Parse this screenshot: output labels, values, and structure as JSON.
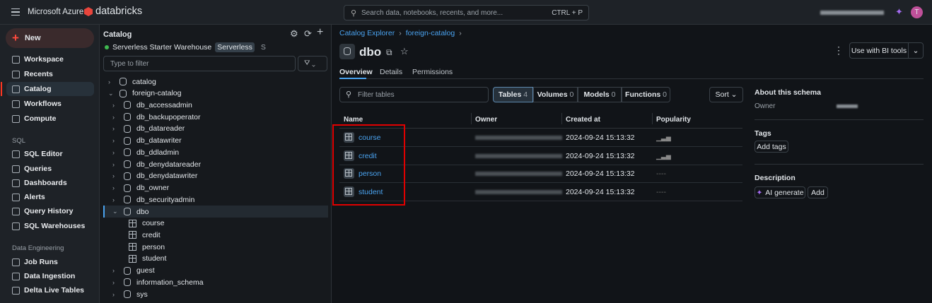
{
  "topbar": {
    "brand": "Microsoft Azure",
    "product": "databricks",
    "search_placeholder": "Search data, notebooks, recents, and more...",
    "search_shortcut": "CTRL + P",
    "avatar": "T"
  },
  "sidebar": {
    "new_label": "New",
    "items": [
      "Workspace",
      "Recents",
      "Catalog",
      "Workflows",
      "Compute"
    ],
    "sql_heading": "SQL",
    "sql_items": [
      "SQL Editor",
      "Queries",
      "Dashboards",
      "Alerts",
      "Query History",
      "SQL Warehouses"
    ],
    "de_heading": "Data Engineering",
    "de_items": [
      "Job Runs",
      "Data Ingestion",
      "Delta Live Tables"
    ]
  },
  "catalog": {
    "title": "Catalog",
    "warehouse": "Serverless Starter Warehouse",
    "warehouse_badge": "Serverless",
    "warehouse_size": "S",
    "filter_placeholder": "Type to filter",
    "tree": [
      {
        "label": "catalog",
        "level": 0,
        "open": false,
        "type": "catalog"
      },
      {
        "label": "foreign-catalog",
        "level": 0,
        "open": true,
        "type": "catalog"
      },
      {
        "label": "db_accessadmin",
        "level": 1,
        "type": "schema"
      },
      {
        "label": "db_backupoperator",
        "level": 1,
        "type": "schema"
      },
      {
        "label": "db_datareader",
        "level": 1,
        "type": "schema"
      },
      {
        "label": "db_datawriter",
        "level": 1,
        "type": "schema"
      },
      {
        "label": "db_ddladmin",
        "level": 1,
        "type": "schema"
      },
      {
        "label": "db_denydatareader",
        "level": 1,
        "type": "schema"
      },
      {
        "label": "db_denydatawriter",
        "level": 1,
        "type": "schema"
      },
      {
        "label": "db_owner",
        "level": 1,
        "type": "schema"
      },
      {
        "label": "db_securityadmin",
        "level": 1,
        "type": "schema"
      },
      {
        "label": "dbo",
        "level": 1,
        "open": true,
        "selected": true,
        "type": "schema"
      },
      {
        "label": "course",
        "level": 2,
        "type": "table"
      },
      {
        "label": "credit",
        "level": 2,
        "type": "table"
      },
      {
        "label": "person",
        "level": 2,
        "type": "table"
      },
      {
        "label": "student",
        "level": 2,
        "type": "table"
      },
      {
        "label": "guest",
        "level": 1,
        "type": "schema"
      },
      {
        "label": "information_schema",
        "level": 1,
        "type": "schema"
      },
      {
        "label": "sys",
        "level": 1,
        "type": "schema"
      }
    ]
  },
  "main": {
    "breadcrumb": [
      "Catalog Explorer",
      "foreign-catalog"
    ],
    "title": "dbo",
    "bi_button": "Use with BI tools",
    "tabs": [
      "Overview",
      "Details",
      "Permissions"
    ],
    "filter_placeholder": "Filter tables",
    "segments": [
      {
        "label": "Tables",
        "count": "4"
      },
      {
        "label": "Volumes",
        "count": "0"
      },
      {
        "label": "Models",
        "count": "0"
      },
      {
        "label": "Functions",
        "count": "0"
      }
    ],
    "sort_label": "Sort",
    "columns": [
      "Name",
      "Owner",
      "Created at",
      "Popularity"
    ],
    "rows": [
      {
        "name": "course",
        "created": "2024-09-24 15:13:32",
        "popularity": "low"
      },
      {
        "name": "credit",
        "created": "2024-09-24 15:13:32",
        "popularity": "low"
      },
      {
        "name": "person",
        "created": "2024-09-24 15:13:32",
        "popularity": "----"
      },
      {
        "name": "student",
        "created": "2024-09-24 15:13:32",
        "popularity": "----"
      }
    ]
  },
  "about": {
    "heading": "About this schema",
    "owner_label": "Owner",
    "tags_heading": "Tags",
    "add_tags": "Add tags",
    "desc_heading": "Description",
    "ai_generate": "AI generate",
    "add": "Add"
  },
  "colors": {
    "accent": "#4aa3f0",
    "highlight": "#e00000",
    "brand": "#ff3621"
  }
}
